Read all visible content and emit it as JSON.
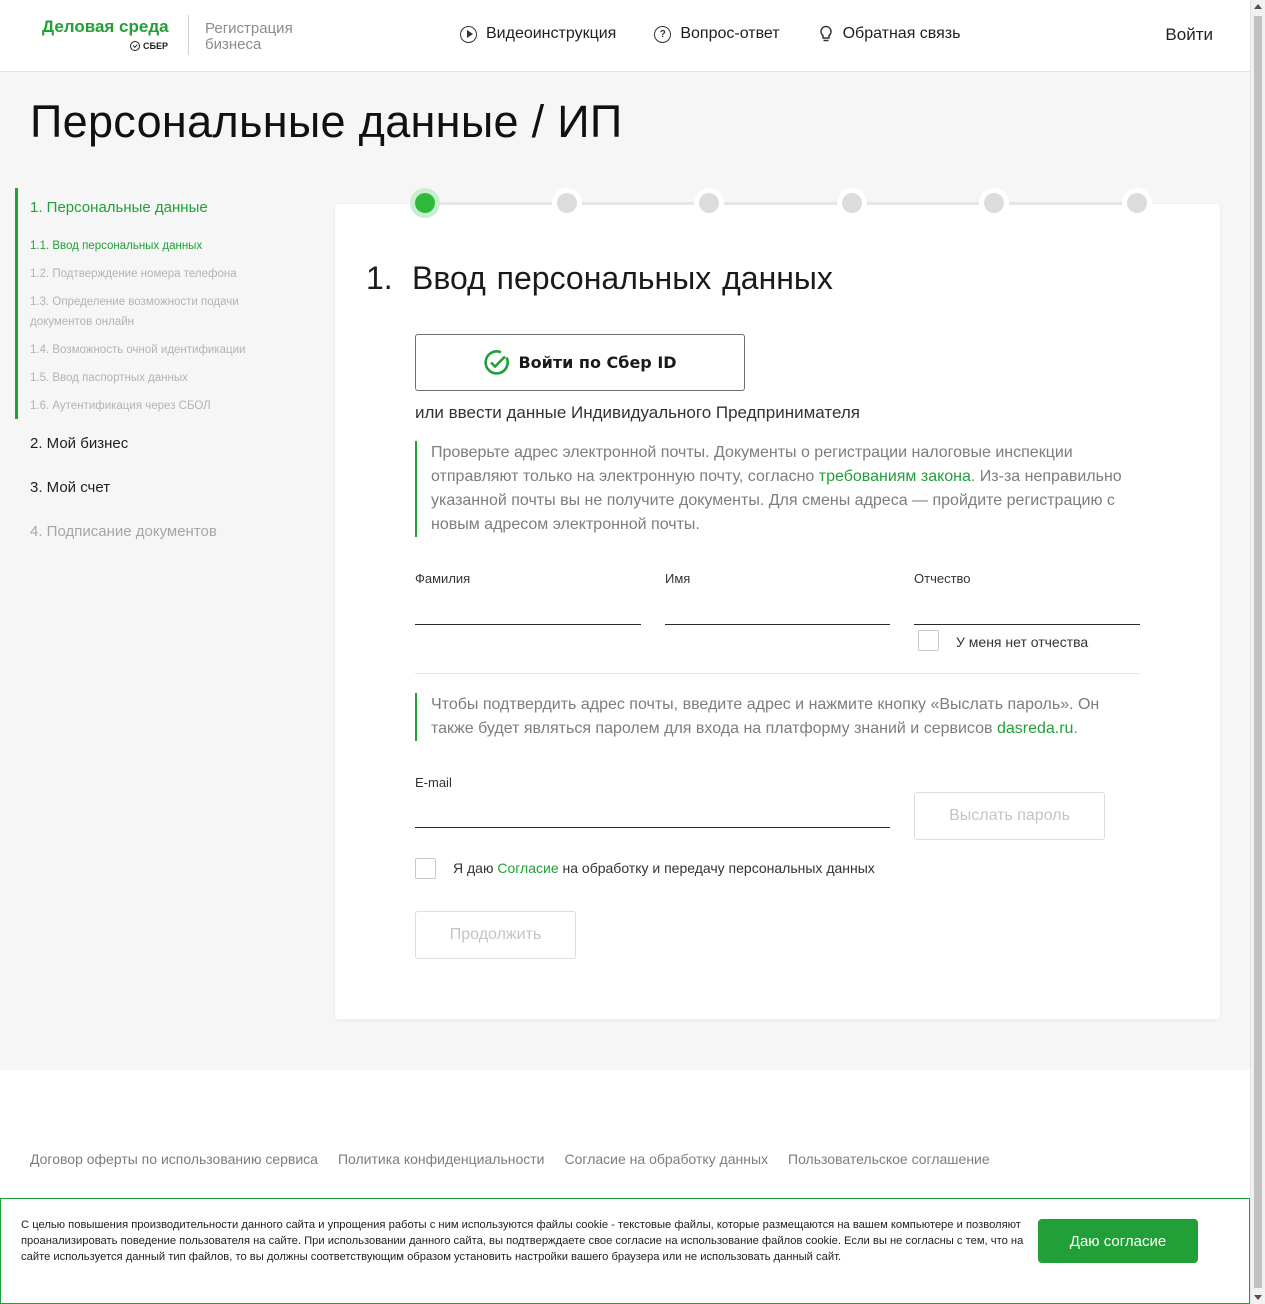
{
  "header": {
    "logo_title": "Деловая среда",
    "logo_sub": "СБЕР",
    "logo_registration": "Регистрация бизнеса",
    "nav": [
      {
        "label": "Видеоинструкция",
        "icon": "play-circle-icon"
      },
      {
        "label": "Вопрос-ответ",
        "icon": "question-circle-icon"
      },
      {
        "label": "Обратная связь",
        "icon": "lightbulb-icon"
      }
    ],
    "login": "Войти"
  },
  "page_title": "Персональные данные / ИП",
  "steps": {
    "step1": "1. Персональные данные",
    "sub": [
      "1.1. Ввод персональных данных",
      "1.2. Подтверждение номера телефона",
      "1.3. Определение возможности подачи документов онлайн",
      "1.4. Возможность очной идентификации",
      "1.5. Ввод паспортных данных",
      "1.6. Аутентификация через СБОЛ"
    ],
    "step2": "2. Мой бизнес",
    "step3": "3. Мой счет",
    "step4": "4. Подписание документов"
  },
  "progress": {
    "total": 6,
    "current": 1
  },
  "card": {
    "number": "1.",
    "title": "Ввод персональных данных",
    "sber_id_button": "Войти по Сбер ID",
    "or_text": "или ввести данные Индивидуального Предпринимателя",
    "notice1_before": "Проверьте адрес электронной почты. Документы о регистрации налоговые инспекции отправляют только на электронную почту, согласно ",
    "notice1_link": "требованиям закона",
    "notice1_after": ". Из-за неправильно указанной почты вы не получите документы. Для смены адреса — пройдите регистрацию с новым адресом электронной почты.",
    "surname_label": "Фамилия",
    "name_label": "Имя",
    "patronymic_label": "Отчество",
    "surname_value": "",
    "name_value": "",
    "patronymic_value": "",
    "no_patronymic": "У меня нет отчества",
    "notice2_before": "Чтобы подтвердить адрес почты, введите адрес и нажмите кнопку «Выслать пароль». Он также будет являться паролем для входа на платформу знаний и сервисов ",
    "notice2_link": "dasreda.ru",
    "notice2_after": ".",
    "email_label": "E-mail",
    "email_value": "",
    "send_password": "Выслать пароль",
    "consent_before": "Я даю ",
    "consent_link": "Согласие",
    "consent_after": " на обработку и передачу персональных данных",
    "continue": "Продолжить"
  },
  "footer": {
    "links": [
      "Договор оферты по использованию сервиса",
      "Политика конфиденциальности",
      "Согласие на обработку данных",
      "Пользовательское соглашение"
    ]
  },
  "cookie": {
    "text": "С целью повышения производительности данного сайта и упрощения работы с ним используются файлы cookie - текстовые файлы, которые размещаются на вашем компьютере и позволяют проанализировать поведение пользователя на сайте. При использовании данного сайта, вы подтверждаете свое согласие на использование файлов cookie. Если вы не согласны с тем, что на сайте используется данный тип файлов, то вы должны соответствующим образом установить настройки вашего браузера или не использовать данный сайт.",
    "button": "Даю согласие"
  },
  "colors": {
    "accent": "#21a038",
    "muted": "#a6a6a6"
  }
}
